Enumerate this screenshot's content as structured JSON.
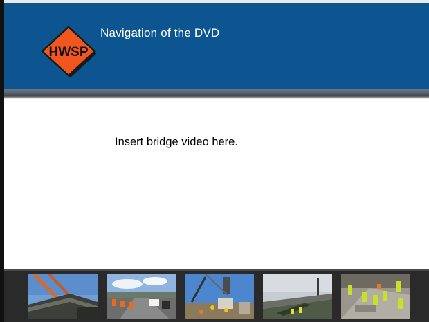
{
  "header": {
    "logo_text": "HWSP",
    "title": "Navigation of the DVD"
  },
  "content": {
    "placeholder_text": "Insert bridge video here."
  },
  "filmstrip": {
    "thumbnails": [
      {
        "subject": "steel-girder-crane-photo"
      },
      {
        "subject": "highway-traffic-cones-photo"
      },
      {
        "subject": "crane-construction-site-photo"
      },
      {
        "subject": "bridge-overpass-photo"
      },
      {
        "subject": "road-workers-photo"
      }
    ]
  },
  "colors": {
    "header_blue": "#0c5590",
    "logo_orange": "#f0561d",
    "filmstrip_dark": "#2a2a2a"
  }
}
